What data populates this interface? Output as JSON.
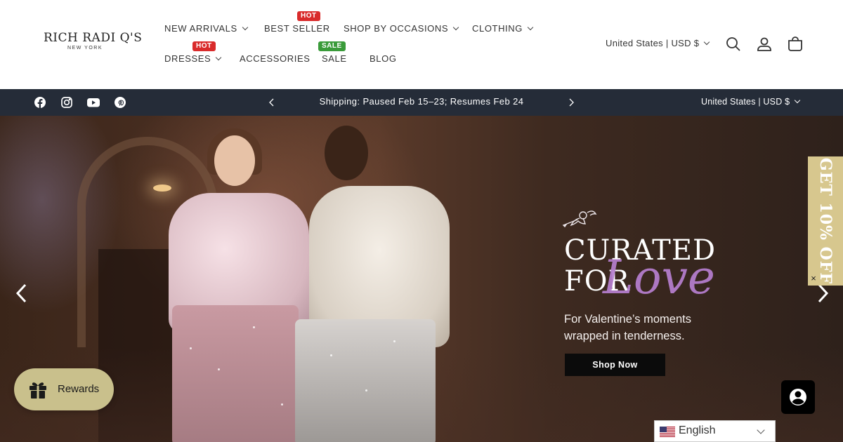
{
  "brand": {
    "name": "RICH RADI Q'S",
    "city": "NEW YORK"
  },
  "nav": {
    "new_arrivals": "NEW ARRIVALS",
    "best_seller": "BEST SELLER",
    "best_seller_badge": "HOT",
    "shop_by_occasions": "SHOP BY OCCASIONS",
    "clothing": "CLOTHING",
    "dresses": "DRESSES",
    "dresses_badge": "HOT",
    "accessories": "ACCESSORIES",
    "sale": "SALE",
    "sale_badge": "SALE",
    "blog": "BLOG"
  },
  "header": {
    "currency": "United States | USD $",
    "icons": [
      "search-icon",
      "account-icon",
      "cart-icon"
    ]
  },
  "announcement": {
    "text": "Shipping: Paused Feb 15–23; Resumes Feb 24",
    "currency": "United States | USD $",
    "social_icons": [
      "facebook-icon",
      "instagram-icon",
      "youtube-icon",
      "pinterest-icon"
    ]
  },
  "hero": {
    "title_line1": "CURATED",
    "title_line2": "FOR",
    "title_script": "Love",
    "subtitle_line1": "For Valentine’s moments",
    "subtitle_line2": "wrapped in tenderness.",
    "button": "Shop Now"
  },
  "side_tab": {
    "text": "GET 10% OFF",
    "close": "×"
  },
  "rewards": {
    "label": "Rewards"
  },
  "language": {
    "label": "English"
  },
  "colors": {
    "announcement_bg": "#252c38",
    "hot_badge": "#d92b2b",
    "sale_badge": "#3a9b3a",
    "side_tab": "#d7c78e",
    "rewards": "#c9c08c",
    "script": "#b77fd0"
  }
}
